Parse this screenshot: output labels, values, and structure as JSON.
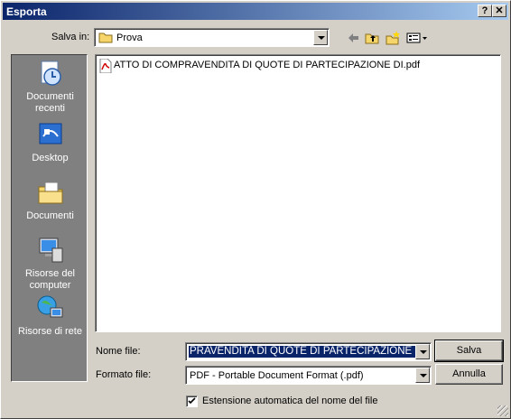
{
  "window": {
    "title": "Esporta",
    "help_label": "?",
    "close_label": "✕"
  },
  "toolbar": {
    "save_in_label": "Salva in:",
    "save_in_value": "Prova"
  },
  "places": [
    {
      "label": "Documenti recenti",
      "icon": "recent-documents-icon"
    },
    {
      "label": "Desktop",
      "icon": "desktop-icon"
    },
    {
      "label": "Documenti",
      "icon": "documents-folder-icon"
    },
    {
      "label": "Risorse del computer",
      "icon": "my-computer-icon"
    },
    {
      "label": "Risorse di rete",
      "icon": "network-icon"
    }
  ],
  "files": [
    {
      "name": "ATTO DI COMPRAVENDITA DI QUOTE DI PARTECIPAZIONE DI.pdf",
      "icon": "pdf-file-icon"
    }
  ],
  "form": {
    "filename_label": "Nome file:",
    "filename_value": "PRAVENDITA DI QUOTE DI PARTECIPAZIONE DI",
    "format_label": "Formato file:",
    "format_value": "PDF - Portable Document Format (.pdf)",
    "save_label": "Salva",
    "cancel_label": "Annulla",
    "auto_ext_label": "Estensione automatica del nome del file",
    "auto_ext_checked": true
  }
}
